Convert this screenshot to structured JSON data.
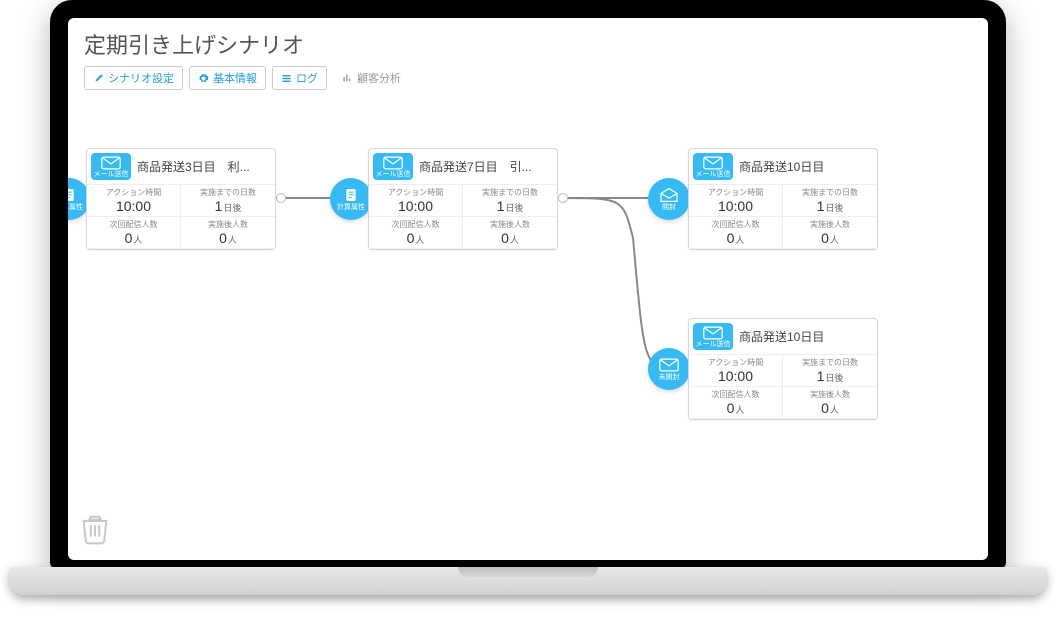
{
  "page_title": "定期引き上げシナリオ",
  "toolbar": {
    "scenario": "シナリオ設定",
    "basic": "基本情報",
    "log": "ログ",
    "analytics": "顧客分析"
  },
  "badge_label": "メール送信",
  "ports": {
    "calc": "計算属性",
    "open": "開封",
    "unopen": "未開封"
  },
  "labels": {
    "action_time": "アクション時間",
    "days_until": "実施までの日数",
    "next_count": "次回配信人数",
    "done_count": "実施後人数",
    "day_suffix": "日後",
    "person_suffix": "人"
  },
  "nodes": [
    {
      "title": "商品発送3日目　利...",
      "time": "10:00",
      "days": "1",
      "next": "0",
      "done": "0"
    },
    {
      "title": "商品発送7日目　引...",
      "time": "10:00",
      "days": "1",
      "next": "0",
      "done": "0"
    },
    {
      "title": "商品発送10日目",
      "time": "10:00",
      "days": "1",
      "next": "0",
      "done": "0"
    },
    {
      "title": "商品発送10日目",
      "time": "10:00",
      "days": "1",
      "next": "0",
      "done": "0"
    }
  ]
}
